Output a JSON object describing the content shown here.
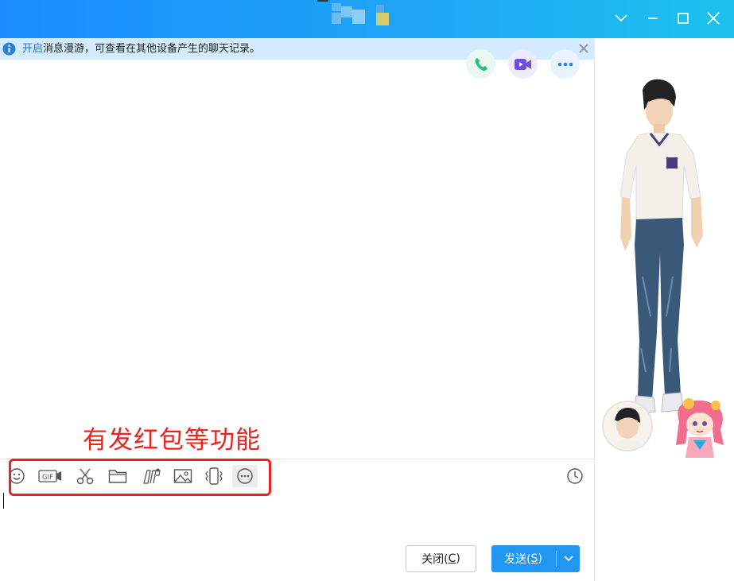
{
  "window": {
    "title_redacted": true,
    "controls": [
      "chevron-down",
      "minimize",
      "maximize",
      "close"
    ]
  },
  "notice": {
    "link": "开启",
    "text": "消息漫游，可查看在其他设备产生的聊天记录。"
  },
  "header_actions": [
    "voice-call",
    "video-call",
    "more"
  ],
  "annotation": {
    "text": "有发红包等功能"
  },
  "toolbar": {
    "tools": [
      "emoji",
      "gif",
      "screenshot",
      "file",
      "screen-record",
      "image",
      "shake",
      "more"
    ],
    "gif_label": "GIF"
  },
  "buttons": {
    "close_label": "关闭(",
    "close_key": "C",
    "close_suffix": ")",
    "send_label": "发送(",
    "send_key": "S",
    "send_suffix": ")"
  },
  "colors": {
    "titlebar_start": "#1a8cff",
    "titlebar_end": "#1dc2ee",
    "notice_bg": "#d3ebfc",
    "link": "#1a6fd9",
    "annotation": "#e8241e",
    "send_button": "#2196f3"
  }
}
